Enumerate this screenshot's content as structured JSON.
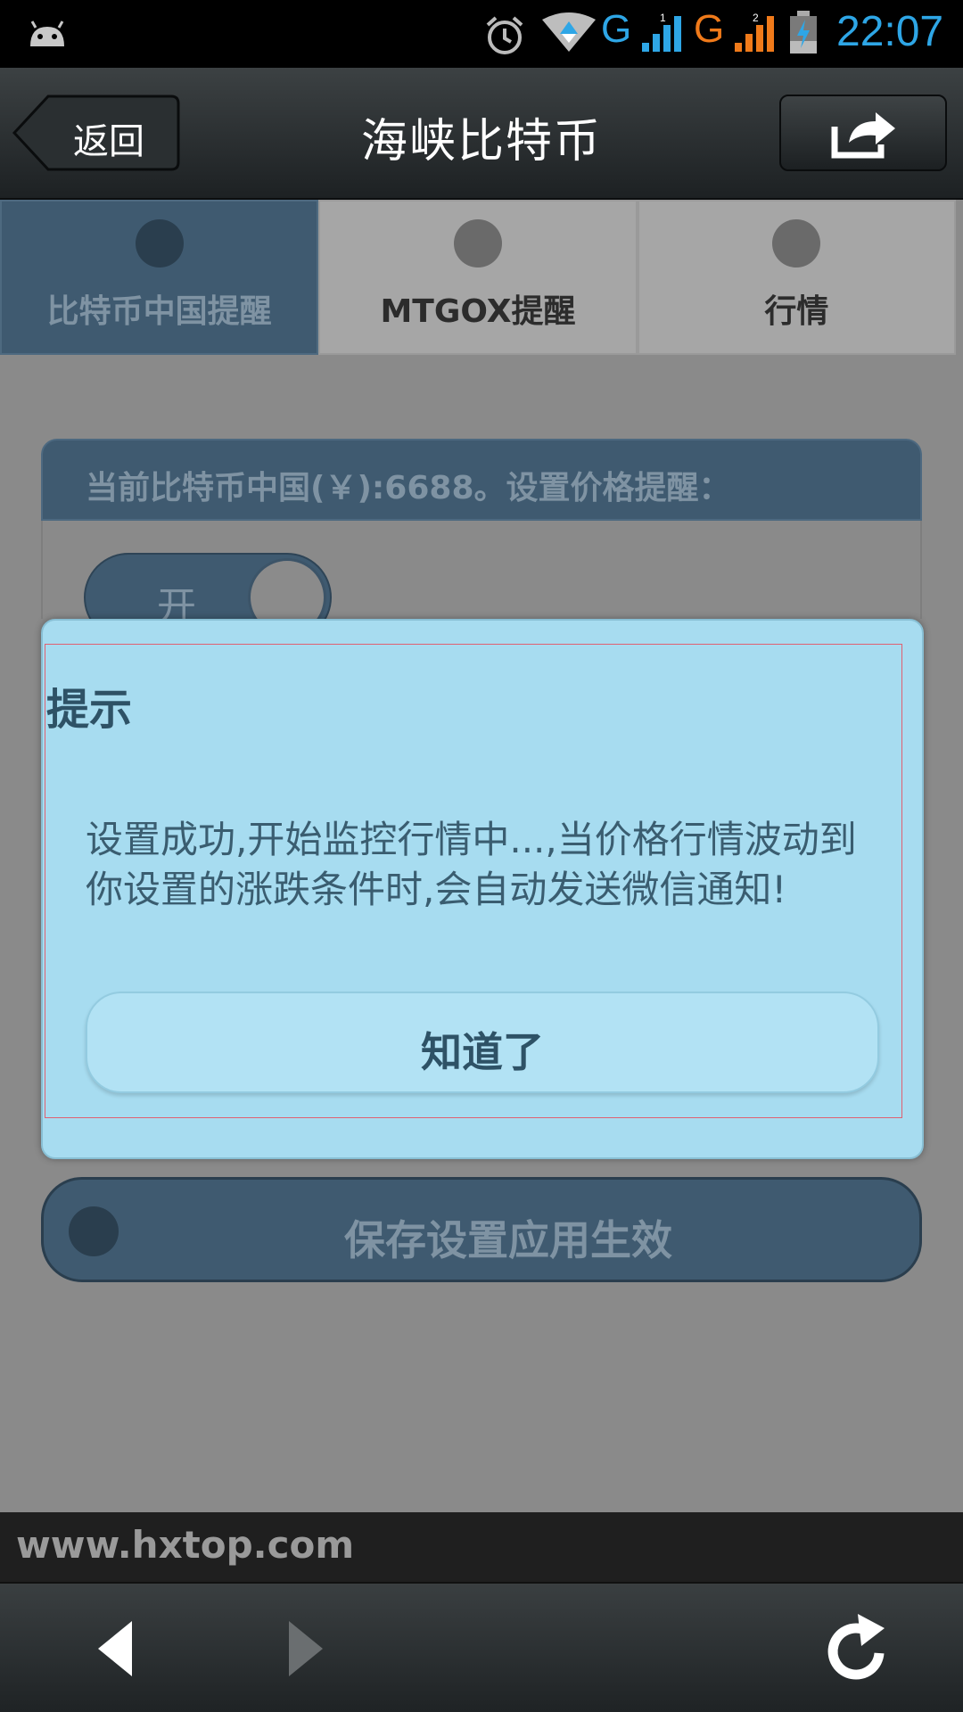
{
  "status_bar": {
    "network_1": "G",
    "network_2": "G",
    "sim_1": "1",
    "sim_2": "2",
    "time": "22:07",
    "icons": [
      "android-icon",
      "alarm-icon",
      "wifi-icon",
      "signal-icon",
      "battery-charging-icon"
    ]
  },
  "header": {
    "back_label": "返回",
    "title": "海峡比特币",
    "share_icon": "share-icon"
  },
  "tabs": [
    {
      "label": "比特币中国提醒",
      "active": true
    },
    {
      "label": "MTGOX提醒",
      "active": false
    },
    {
      "label": "行情",
      "active": false
    }
  ],
  "card": {
    "header_text": "当前比特币中国(￥):6688。设置价格提醒：",
    "toggle_label": "开"
  },
  "save_button": {
    "label": "保存设置应用生效"
  },
  "dialog": {
    "title": "提示",
    "message": "设置成功,开始监控行情中...,当价格行情波动到你设置的涨跌条件时,会自动发送微信通知!",
    "ok_label": "知道了"
  },
  "footer": {
    "url": "www.hxtop.com"
  },
  "colors": {
    "accent_blue": "#3f5a70",
    "dialog_bg": "#a7dcf0",
    "status_blue": "#2ea6e6",
    "status_orange": "#f07a1a"
  }
}
